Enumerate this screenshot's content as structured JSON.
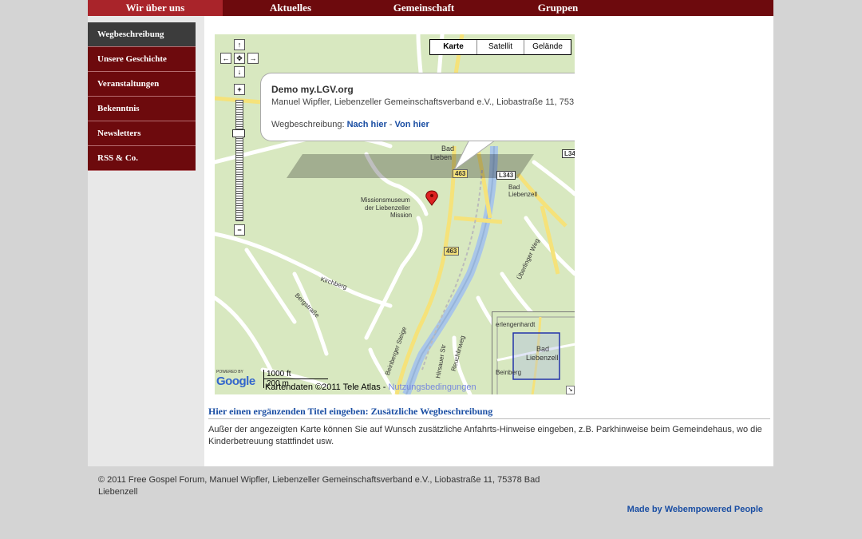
{
  "topnav": {
    "tabs": [
      {
        "label": "Wir über uns",
        "active": true
      },
      {
        "label": "Aktuelles",
        "active": false
      },
      {
        "label": "Gemeinschaft",
        "active": false
      },
      {
        "label": "Gruppen",
        "active": false
      }
    ]
  },
  "sidebar": {
    "items": [
      {
        "label": "Wegbeschreibung",
        "active": true
      },
      {
        "label": "Unsere Geschichte",
        "active": false
      },
      {
        "label": "Veranstaltungen",
        "active": false
      },
      {
        "label": "Bekenntnis",
        "active": false
      },
      {
        "label": "Newsletters",
        "active": false
      },
      {
        "label": "RSS & Co.",
        "active": false
      }
    ]
  },
  "map": {
    "type_buttons": [
      "Karte",
      "Satellit",
      "Gelände"
    ],
    "selected_type": "Karte",
    "info_window": {
      "title": "Demo my.LGV.org",
      "address": "Manuel Wipfler, Liebenzeller Gemeinschaftsverband e.V., Liobastraße 11, 753",
      "directions_label": "Wegbeschreibung:",
      "link_to": "Nach hier",
      "separator": "-",
      "link_from": "Von hier"
    },
    "labels": {
      "museum1": "Missionsmuseum",
      "museum2": "der Liebenzeller",
      "museum3": "Mission",
      "bad1": "Bad",
      "bad2": "Liebenzell",
      "bad_top1": "Bad",
      "bad_top2": "Lieben",
      "road463a": "463",
      "road463b": "463",
      "l343a": "L343",
      "l343b": "L34",
      "kirchberg": "Kirchberg",
      "bergstrasse": "Bergstraße",
      "reuchlinweg": "Reuchlinweg",
      "hirsauer": "Hirsauer Str",
      "beinberger": "Beinberger Steige",
      "ueberweg": "Überlinger Weg"
    },
    "overview": {
      "label1": "Bad",
      "label2": "Liebenzell",
      "corner1": "erlengenhardt",
      "corner2": "Beinberg"
    },
    "scale": {
      "ft": "1000 ft",
      "m": "200 m"
    },
    "copyright_text": "Kartendaten ©2011 Tele Atlas -",
    "terms_link": "Nutzungsbedingungen",
    "google_small": "POWERED BY",
    "google_logo": "Google",
    "colors": {
      "road_yellow": "#f5e27a",
      "river": "#a9c6e8",
      "land": "#d8e8c0"
    }
  },
  "content": {
    "section_title": "Hier einen ergänzenden Titel eingeben: Zusätzliche Wegbeschreibung",
    "section_text": "Außer der angezeigten Karte können Sie auf Wunsch zusätzliche Anfahrts-Hinweise eingeben, z.B. Parkhinweise beim Gemeindehaus, wo die Kinderbetreuung stattfindet usw."
  },
  "footer": {
    "copyright": "© 2011 Free Gospel Forum, Manuel Wipfler, Liebenzeller Gemeinschaftsverband e.V., Liobastraße 11, 75378 Bad Liebenzell",
    "made_by": "Made by Webempowered People"
  }
}
